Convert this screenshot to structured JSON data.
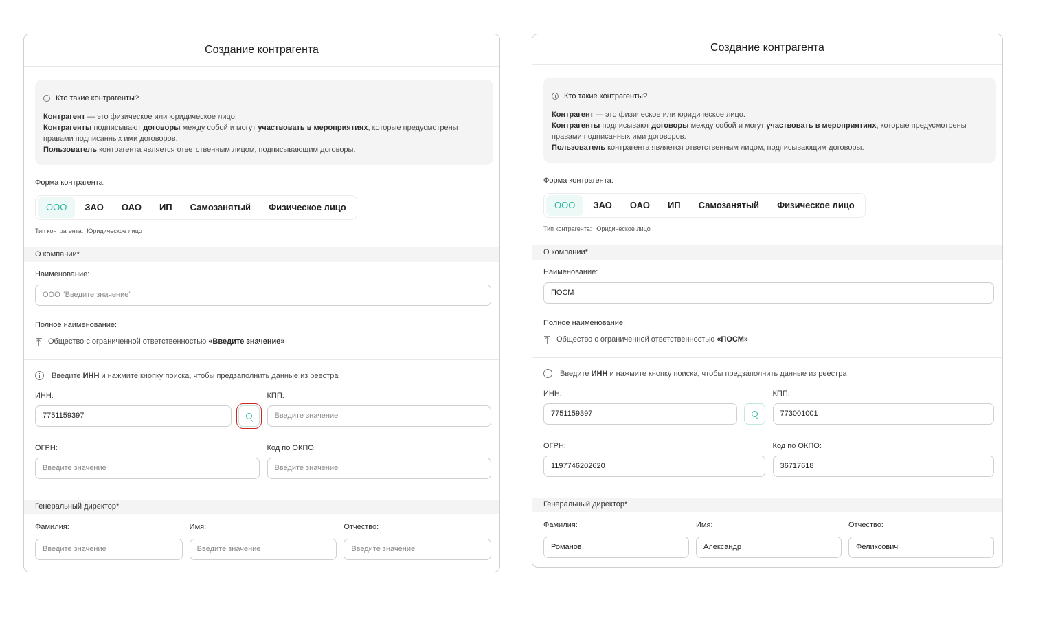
{
  "panels": [
    {
      "title": "Создание контрагента",
      "info": {
        "title": "Кто такие контрагенты?",
        "line1": [
          {
            "t": "Контрагент",
            "b": true
          },
          {
            "t": " — это физическое или юридическое лицо.",
            "b": false
          }
        ],
        "line2": [
          {
            "t": "Контрагенты",
            "b": true
          },
          {
            "t": " подписывают ",
            "b": false
          },
          {
            "t": "договоры",
            "b": true
          },
          {
            "t": " между собой и могут ",
            "b": false
          },
          {
            "t": "участвовать в мероприятиях",
            "b": true
          },
          {
            "t": ", которые предусмотрены правами подписанных ими договоров.",
            "b": false
          }
        ],
        "line3": [
          {
            "t": "Пользователь",
            "b": true
          },
          {
            "t": " контрагента является ответственным лицом, подписывающим договоры.",
            "b": false
          }
        ]
      },
      "form_label": "Форма контрагента:",
      "forms": [
        "ООО",
        "ЗАО",
        "ОАО",
        "ИП",
        "Самозанятый",
        "Физическое лицо"
      ],
      "active_form": "ООО",
      "type_label": "Тип контрагента:",
      "type_value": "Юридическое лицо",
      "about_section": "О компании*",
      "name_label": "Наименование:",
      "name_value": "",
      "name_placeholder": "ООО \"Введите значение\"",
      "fullname_label": "Полное наименование:",
      "fullname_prefix": "Общество с ограниченной ответственностью ",
      "fullname_value": "«Введите значение»",
      "hint": [
        {
          "t": "Введите ",
          "b": false
        },
        {
          "t": "ИНН",
          "b": true
        },
        {
          "t": " и нажмите кнопку поиска, чтобы предзаполнить данные из реестра",
          "b": false
        }
      ],
      "inn_label": "ИНН:",
      "inn_value": "7751159397",
      "kpp_label": "КПП:",
      "kpp_value": "",
      "ogrn_label": "ОГРН:",
      "ogrn_value": "",
      "okpo_label": "Код по ОКПО:",
      "okpo_value": "",
      "director_section": "Генеральный директор*",
      "lastname_label": "Фамилия:",
      "lastname_value": "",
      "firstname_label": "Имя:",
      "firstname_value": "",
      "patronymic_label": "Отчество:",
      "patronymic_value": "",
      "placeholder": "Введите значение",
      "search_highlighted": true
    },
    {
      "title": "Создание контрагента",
      "info": {
        "title": "Кто такие контрагенты?",
        "line1": [
          {
            "t": "Контрагент",
            "b": true
          },
          {
            "t": " — это физическое или юридическое лицо.",
            "b": false
          }
        ],
        "line2": [
          {
            "t": "Контрагенты",
            "b": true
          },
          {
            "t": " подписывают ",
            "b": false
          },
          {
            "t": "договоры",
            "b": true
          },
          {
            "t": " между собой и могут ",
            "b": false
          },
          {
            "t": "участвовать в мероприятиях",
            "b": true
          },
          {
            "t": ", которые предусмотрены правами подписанных ими договоров.",
            "b": false
          }
        ],
        "line3": [
          {
            "t": "Пользователь",
            "b": true
          },
          {
            "t": " контрагента является ответственным лицом, подписывающим договоры.",
            "b": false
          }
        ]
      },
      "form_label": "Форма контрагента:",
      "forms": [
        "ООО",
        "ЗАО",
        "ОАО",
        "ИП",
        "Самозанятый",
        "Физическое лицо"
      ],
      "active_form": "ООО",
      "type_label": "Тип контрагента:",
      "type_value": "Юридическое лицо",
      "about_section": "О компании*",
      "name_label": "Наименование:",
      "name_value": "ПОСМ",
      "name_placeholder": "ООО \"Введите значение\"",
      "fullname_label": "Полное наименование:",
      "fullname_prefix": "Общество с ограниченной ответственностью ",
      "fullname_value": "«ПОСМ»",
      "hint": [
        {
          "t": "Введите ",
          "b": false
        },
        {
          "t": "ИНН",
          "b": true
        },
        {
          "t": " и нажмите кнопку поиска, чтобы предзаполнить данные из реестра",
          "b": false
        }
      ],
      "inn_label": "ИНН:",
      "inn_value": "7751159397",
      "kpp_label": "КПП:",
      "kpp_value": "773001001",
      "ogrn_label": "ОГРН:",
      "ogrn_value": "1197746202620",
      "okpo_label": "Код по ОКПО:",
      "okpo_value": "36717618",
      "director_section": "Генеральный директор*",
      "lastname_label": "Фамилия:",
      "lastname_value": "Романов",
      "firstname_label": "Имя:",
      "firstname_value": "Александр",
      "patronymic_label": "Отчество:",
      "patronymic_value": "Феликсович",
      "placeholder": "Введите значение",
      "search_highlighted": false
    }
  ],
  "colors": {
    "accent": "#2ab5a2",
    "accent_bg": "#edf9f6",
    "highlight": "#cc2727"
  }
}
